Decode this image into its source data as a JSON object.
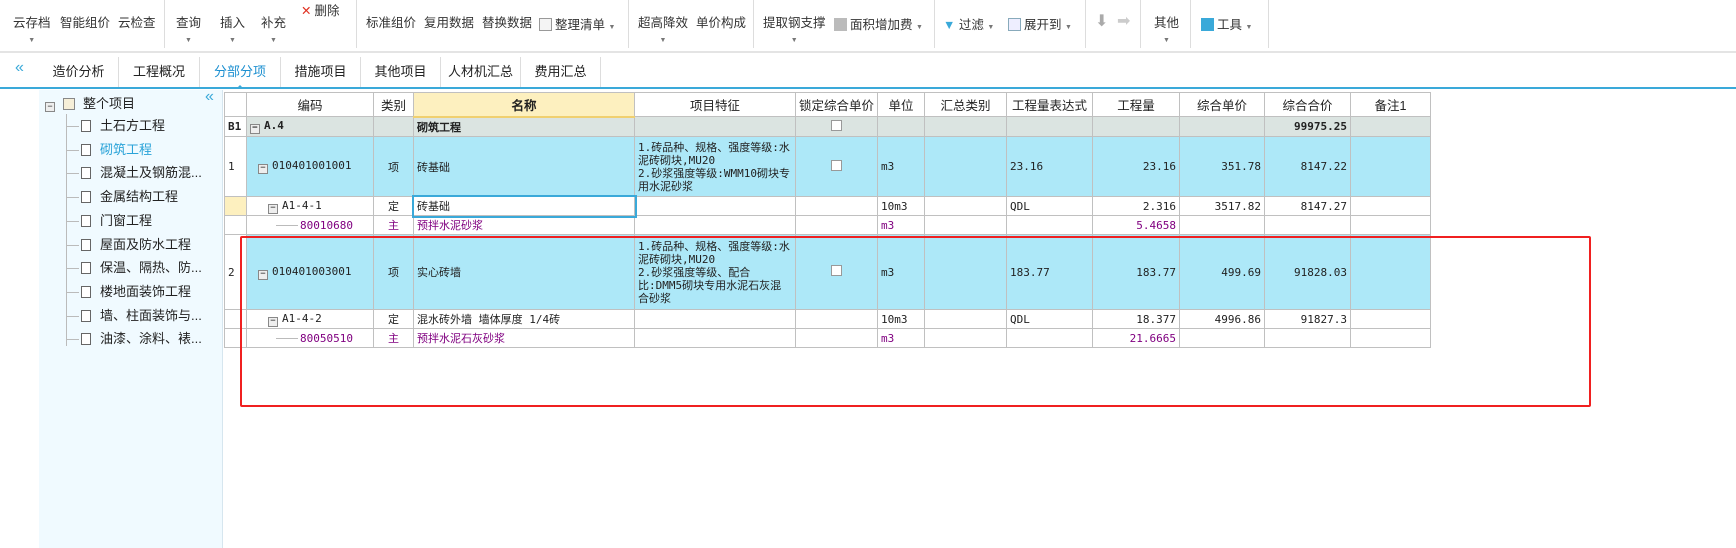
{
  "toolbar": {
    "cloud_save": "云存档",
    "smart_price": "智能组价",
    "cloud_check": "云检查",
    "query": "查询",
    "insert": "插入",
    "supplement": "补充",
    "delete": "删除",
    "std_price": "标准组价",
    "reuse_data": "复用数据",
    "replace_data": "替换数据",
    "organize_list": "整理清单",
    "high_rise": "超高降效",
    "unit_price_comp": "单价构成",
    "steel_support": "提取钢支撑",
    "area_fee": "面积增加费",
    "filter": "过滤",
    "expand_to": "展开到",
    "other": "其他",
    "tools": "工具"
  },
  "tabs": [
    "造价分析",
    "工程概况",
    "分部分项",
    "措施项目",
    "其他项目",
    "人材机汇总",
    "费用汇总"
  ],
  "active_tab": "分部分项",
  "sidebar": {
    "root": "整个项目",
    "items": [
      "土石方工程",
      "砌筑工程",
      "混凝土及钢筋混...",
      "金属结构工程",
      "门窗工程",
      "屋面及防水工程",
      "保温、隔热、防...",
      "楼地面装饰工程",
      "墙、柱面装饰与...",
      "油漆、涂料、裱..."
    ],
    "selected": "砌筑工程"
  },
  "colors": {
    "accent": "#3aa9d9",
    "list_row": "#ade8f8",
    "material": "#800080",
    "highlight_box": "#f02020"
  },
  "table": {
    "headers": [
      "",
      "编码",
      "类别",
      "名称",
      "项目特征",
      "锁定综合单价",
      "单位",
      "汇总类别",
      "工程量表达式",
      "工程量",
      "综合单价",
      "综合合价",
      "备注1"
    ],
    "b1": {
      "no": "B1",
      "code": "A.4",
      "name": "砌筑工程",
      "total": "99975.25"
    },
    "rows": [
      {
        "no": "1",
        "code": "010401001001",
        "type": "项",
        "name": "砖基础",
        "feature": "1.砖品种、规格、强度等级:水泥砖砌块,MU20\n2.砂浆强度等级:WMM10砌块专用水泥砂浆",
        "unit": "m3",
        "expr": "23.16",
        "qty": "23.16",
        "price": "351.78",
        "total": "8147.22"
      },
      {
        "code": "A1-4-1",
        "type": "定",
        "name": "砖基础",
        "unit": "10m3",
        "expr": "QDL",
        "qty": "2.316",
        "price": "3517.82",
        "total": "8147.27"
      },
      {
        "code": "80010680",
        "type": "主",
        "name": "预拌水泥砂浆",
        "unit": "m3",
        "qty": "5.4658"
      },
      {
        "no": "2",
        "code": "010401003001",
        "type": "项",
        "name": "实心砖墙",
        "feature": "1.砖品种、规格、强度等级:水泥砖砌块,MU20\n2.砂浆强度等级、配合比:DMM5砌块专用水泥石灰混合砂浆",
        "unit": "m3",
        "expr": "183.77",
        "qty": "183.77",
        "price": "499.69",
        "total": "91828.03"
      },
      {
        "code": "A1-4-2",
        "type": "定",
        "name": "混水砖外墙 墙体厚度 1/4砖",
        "unit": "10m3",
        "expr": "QDL",
        "qty": "18.377",
        "price": "4996.86",
        "total": "91827.3"
      },
      {
        "code": "80050510",
        "type": "主",
        "name": "预拌水泥石灰砂浆",
        "unit": "m3",
        "qty": "21.6665"
      }
    ]
  }
}
